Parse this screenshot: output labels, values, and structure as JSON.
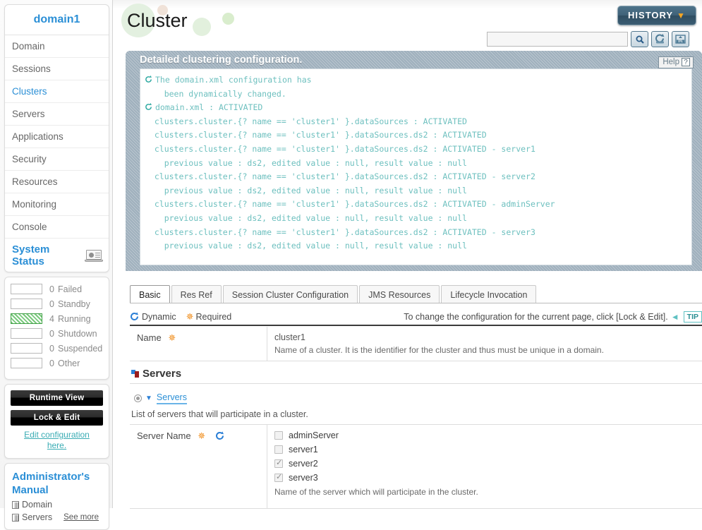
{
  "sidebar": {
    "domain_title": "domain1",
    "nav_items": [
      {
        "label": "Domain",
        "active": false
      },
      {
        "label": "Sessions",
        "active": false
      },
      {
        "label": "Clusters",
        "active": true
      },
      {
        "label": "Servers",
        "active": false
      },
      {
        "label": "Applications",
        "active": false
      },
      {
        "label": "Security",
        "active": false
      },
      {
        "label": "Resources",
        "active": false
      },
      {
        "label": "Monitoring",
        "active": false
      },
      {
        "label": "Console",
        "active": false
      }
    ],
    "system_status": {
      "title": "System Status",
      "icon": "laptop-icon",
      "rows": [
        {
          "count": "0",
          "label": "Failed",
          "filled": false
        },
        {
          "count": "0",
          "label": "Standby",
          "filled": false
        },
        {
          "count": "4",
          "label": "Running",
          "filled": true
        },
        {
          "count": "0",
          "label": "Shutdown",
          "filled": false
        },
        {
          "count": "0",
          "label": "Suspended",
          "filled": false
        },
        {
          "count": "0",
          "label": "Other",
          "filled": false
        }
      ]
    },
    "runtime_view_button": "Runtime View",
    "lock_edit_button": "Lock & Edit",
    "edit_config_link_line1": "Edit configuration",
    "edit_config_link_line2": "here.",
    "admin_manual": {
      "title_line1": "Administrator's",
      "title_line2": "Manual",
      "links": [
        "Domain",
        "Servers"
      ],
      "see_more": "See more"
    }
  },
  "header": {
    "page_title": "Cluster",
    "history_button": "HISTORY",
    "history_chevron": "chevron-down-icon",
    "search_value": "",
    "search_placeholder": "",
    "tools": [
      {
        "name": "search-icon",
        "label": "search"
      },
      {
        "name": "refresh-icon",
        "label": "reload"
      },
      {
        "name": "xml-export-icon",
        "label": "xml"
      }
    ]
  },
  "console": {
    "heading": "Detailed clustering configuration.",
    "help_label": "Help",
    "help_icon": "question-icon",
    "lines": [
      {
        "icon": true,
        "text": "The domain.xml configuration has"
      },
      {
        "icon": false,
        "text": "    been dynamically changed."
      },
      {
        "icon": true,
        "text": "domain.xml : ACTIVATED"
      },
      {
        "icon": false,
        "text": "  clusters.cluster.{? name == 'cluster1' }.dataSources : ACTIVATED"
      },
      {
        "icon": false,
        "text": "  clusters.cluster.{? name == 'cluster1' }.dataSources.ds2 : ACTIVATED"
      },
      {
        "icon": false,
        "text": "  clusters.cluster.{? name == 'cluster1' }.dataSources.ds2 : ACTIVATED - server1"
      },
      {
        "icon": false,
        "text": "    previous value : ds2, edited value : null, result value : null"
      },
      {
        "icon": false,
        "text": "  clusters.cluster.{? name == 'cluster1' }.dataSources.ds2 : ACTIVATED - server2"
      },
      {
        "icon": false,
        "text": "    previous value : ds2, edited value : null, result value : null"
      },
      {
        "icon": false,
        "text": "  clusters.cluster.{? name == 'cluster1' }.dataSources.ds2 : ACTIVATED - adminServer"
      },
      {
        "icon": false,
        "text": "    previous value : ds2, edited value : null, result value : null"
      },
      {
        "icon": false,
        "text": "  clusters.cluster.{? name == 'cluster1' }.dataSources.ds2 : ACTIVATED - server3"
      },
      {
        "icon": false,
        "text": "    previous value : ds2, edited value : null, result value : null"
      }
    ]
  },
  "tabs": [
    {
      "label": "Basic",
      "active": true
    },
    {
      "label": "Res Ref",
      "active": false
    },
    {
      "label": "Session Cluster Configuration",
      "active": false
    },
    {
      "label": "JMS Resources",
      "active": false
    },
    {
      "label": "Lifecycle Invocation",
      "active": false
    }
  ],
  "legend": {
    "dynamic": "Dynamic",
    "required": "Required",
    "hint": "To change the configuration for the current page, click [Lock & Edit].",
    "tip_badge": "TIP"
  },
  "form": {
    "name_row": {
      "label": "Name",
      "required": true,
      "value": "cluster1",
      "description": "Name of a cluster. It is the identifier for the cluster and thus must be unique in a domain."
    },
    "servers_section": {
      "heading": "Servers",
      "node_label": "Servers",
      "description": "List of servers that will participate in a cluster.",
      "server_name_label": "Server Name",
      "server_name_description": "Name of the server which will participate in the cluster.",
      "servers": [
        {
          "name": "adminServer",
          "checked": false
        },
        {
          "name": "server1",
          "checked": false
        },
        {
          "name": "server2",
          "checked": true
        },
        {
          "name": "server3",
          "checked": true
        }
      ]
    }
  },
  "colors": {
    "accent_blue": "#2b8fd6",
    "console_bg": "#9fb0bd",
    "console_text": "#6ec0bf",
    "required_orange": "#f08c1a",
    "running_green": "#79c97c",
    "tip_teal": "#3aacb4"
  }
}
